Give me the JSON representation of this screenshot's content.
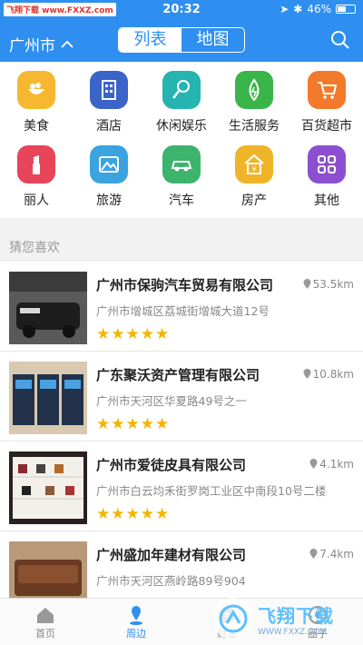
{
  "statusbar": {
    "left_tag": "飞翔下载 www.FXXZ.com",
    "time": "20:32",
    "battery": "46%"
  },
  "navbar": {
    "city": "广州市",
    "tabs": [
      "列表",
      "地图"
    ]
  },
  "categories": [
    {
      "label": "美食",
      "icon": "food-icon",
      "color": "#f5b830"
    },
    {
      "label": "酒店",
      "icon": "hotel-icon",
      "color": "#3a64c8"
    },
    {
      "label": "休闲娱乐",
      "icon": "entertainment-icon",
      "color": "#26b4b0"
    },
    {
      "label": "生活服务",
      "icon": "life-service-icon",
      "color": "#3ab54a"
    },
    {
      "label": "百货超市",
      "icon": "supermarket-icon",
      "color": "#f27a2a"
    },
    {
      "label": "丽人",
      "icon": "beauty-icon",
      "color": "#e8455a"
    },
    {
      "label": "旅游",
      "icon": "travel-icon",
      "color": "#3aa3e0"
    },
    {
      "label": "汽车",
      "icon": "car-icon",
      "color": "#3cb46e"
    },
    {
      "label": "房产",
      "icon": "house-icon",
      "color": "#f0b428"
    },
    {
      "label": "其他",
      "icon": "other-icon",
      "color": "#8c4fd0"
    }
  ],
  "section_title": "猜您喜欢",
  "listings": [
    {
      "name": "广州市保驹汽车贸易有限公司",
      "distance": "53.5km",
      "address": "广州市增城区荔城街增城大道12号",
      "stars": "★★★★★"
    },
    {
      "name": "广东聚沃资产管理有限公司",
      "distance": "10.8km",
      "address": "广州市天河区华夏路49号之一",
      "stars": "★★★★★"
    },
    {
      "name": "广州市爱徒皮具有限公司",
      "distance": "4.1km",
      "address": "广州市白云均禾街罗岗工业区中南段10号二楼",
      "stars": "★★★★★"
    },
    {
      "name": "广州盛加年建材有限公司",
      "distance": "7.4km",
      "address": "广州市天河区燕岭路89号904",
      "stars": ""
    }
  ],
  "tabbar": [
    {
      "label": "首页",
      "icon": "home-icon"
    },
    {
      "label": "周边",
      "icon": "nearby-icon"
    },
    {
      "label": "财富",
      "icon": "wealth-icon"
    },
    {
      "label": "圈子",
      "icon": "circle-icon"
    }
  ],
  "watermark": {
    "text": "飞翔下载",
    "url": "WWW.FXXZ.COM"
  }
}
